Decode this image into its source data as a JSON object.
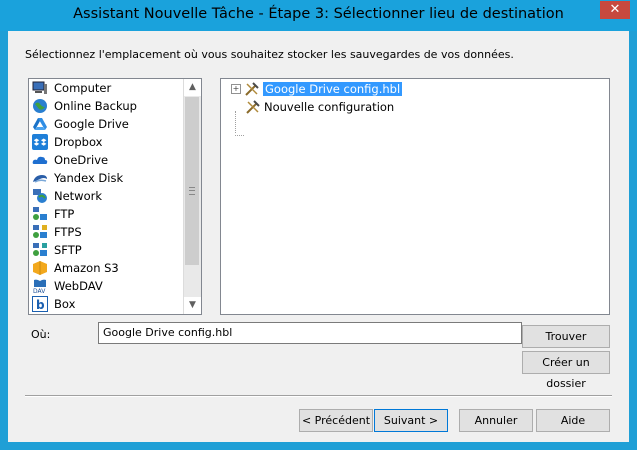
{
  "window": {
    "title": "Assistant Nouvelle Tâche - Étape 3: Sélectionner lieu de destination",
    "close_glyph": "✕"
  },
  "instruction": "Sélectionnez l'emplacement où vous souhaitez stocker les sauvegardes de vos données.",
  "destinations": [
    {
      "label": "Computer",
      "icon": "computer-icon"
    },
    {
      "label": "Online Backup",
      "icon": "globe-icon"
    },
    {
      "label": "Google Drive",
      "icon": "google-drive-icon"
    },
    {
      "label": "Dropbox",
      "icon": "dropbox-icon"
    },
    {
      "label": "OneDrive",
      "icon": "onedrive-icon"
    },
    {
      "label": "Yandex Disk",
      "icon": "yandex-disk-icon"
    },
    {
      "label": "Network",
      "icon": "network-icon"
    },
    {
      "label": "FTP",
      "icon": "ftp-icon"
    },
    {
      "label": "FTPS",
      "icon": "ftps-icon"
    },
    {
      "label": "SFTP",
      "icon": "sftp-icon"
    },
    {
      "label": "Amazon S3",
      "icon": "amazon-s3-icon"
    },
    {
      "label": "WebDAV",
      "icon": "webdav-icon"
    },
    {
      "label": "Box",
      "icon": "box-icon"
    }
  ],
  "tree": {
    "items": [
      {
        "label": "Google Drive config.hbl",
        "expander": "+",
        "selected": true
      },
      {
        "label": "Nouvelle configuration",
        "selected": false
      }
    ]
  },
  "location": {
    "label": "Où:",
    "value": "Google Drive config.hbl"
  },
  "buttons": {
    "browse": "Trouver",
    "create_folder": "Créer un dossier",
    "back": "< Précédent",
    "next": "Suivant >",
    "cancel": "Annuler",
    "help": "Aide"
  },
  "colors": {
    "title_bar": "#1aa2dc",
    "selection": "#3399ff",
    "close_button": "#c7493e"
  }
}
